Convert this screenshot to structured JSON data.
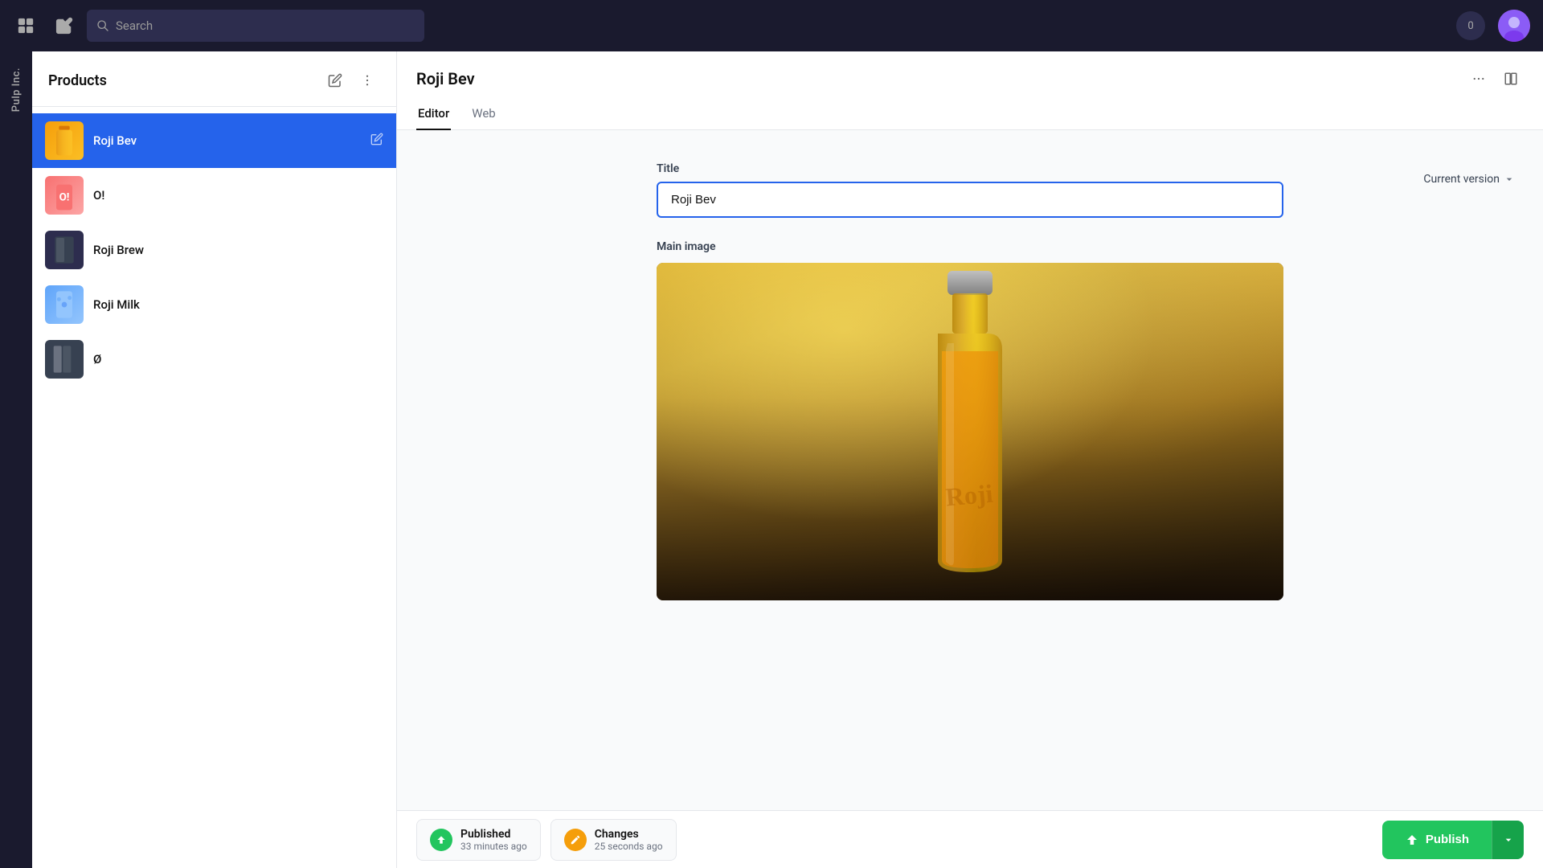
{
  "topNav": {
    "searchPlaceholder": "Search",
    "notificationCount": "0"
  },
  "brandSidebar": {
    "label": "Pulp Inc."
  },
  "productsSidebar": {
    "title": "Products",
    "items": [
      {
        "id": "roji-bev",
        "name": "Roji Bev",
        "active": true,
        "thumbClass": "thumb-roji-bev"
      },
      {
        "id": "o",
        "name": "O!",
        "active": false,
        "thumbClass": "thumb-o"
      },
      {
        "id": "roji-brew",
        "name": "Roji Brew",
        "active": false,
        "thumbClass": "thumb-roji-brew"
      },
      {
        "id": "roji-milk",
        "name": "Roji Milk",
        "active": false,
        "thumbClass": "thumb-roji-milk"
      },
      {
        "id": "o2",
        "name": "Ø",
        "active": false,
        "thumbClass": "thumb-o2"
      }
    ]
  },
  "contentHeader": {
    "title": "Roji Bev",
    "tabs": [
      {
        "id": "editor",
        "label": "Editor",
        "active": true
      },
      {
        "id": "web",
        "label": "Web",
        "active": false
      }
    ],
    "versionLabel": "Current version"
  },
  "editor": {
    "titleLabel": "Title",
    "titleValue": "Roji Bev",
    "mainImageLabel": "Main image"
  },
  "statusBar": {
    "published": {
      "label": "Published",
      "time": "33 minutes ago"
    },
    "changes": {
      "label": "Changes",
      "time": "25 seconds ago"
    },
    "publishButton": "Publish"
  }
}
